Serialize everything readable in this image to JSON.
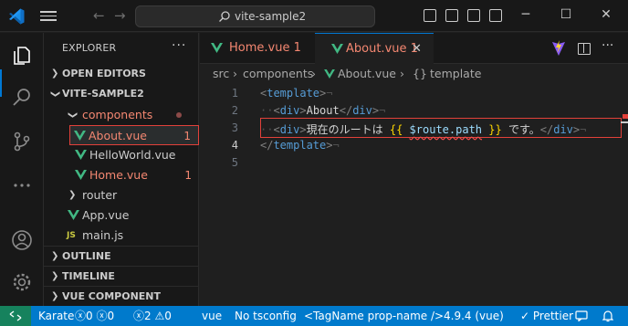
{
  "titlebar": {
    "search_text": "vite-sample2",
    "minimize": "─",
    "maximize": "☐",
    "close": "✕"
  },
  "sidebar": {
    "title": "EXPLORER",
    "sections": {
      "open_editors": "OPEN EDITORS",
      "project": "VITE-SAMPLE2",
      "outline": "OUTLINE",
      "timeline": "TIMELINE",
      "vue_preview": "VUE COMPONENT PREVIEW"
    },
    "tree": {
      "components": "components",
      "about": "About.vue",
      "about_badge": "1",
      "helloworld": "HelloWorld.vue",
      "home": "Home.vue",
      "home_badge": "1",
      "router": "router",
      "app": "App.vue",
      "main": "main.js",
      "js_label": "JS"
    }
  },
  "tabs": [
    {
      "label": "Home.vue 1"
    },
    {
      "label": "About.vue 1",
      "close": "✕"
    }
  ],
  "breadcrumb": {
    "src": "src",
    "components": "components",
    "file": "About.vue",
    "symbol": "template",
    "symbol_prefix": "{}"
  },
  "editor": {
    "line_numbers": [
      "1",
      "2",
      "3",
      "4",
      "5"
    ],
    "line1": {
      "open": "<",
      "tag": "template",
      "close": ">",
      "ws": "¬"
    },
    "line2": {
      "indent": "··",
      "open": "<",
      "tag": "div",
      "close": ">",
      "text": "About",
      "end_open": "</",
      "end_tag": "div",
      "end_close": ">",
      "ws": "¬"
    },
    "line3": {
      "indent": "··",
      "open": "<",
      "tag": "div",
      "close": ">",
      "text_before": "現在のルートは",
      "brace_open": "{{",
      "var": "$route.path",
      "brace_close": "}}",
      "text_after": "です。",
      "end_open": "</",
      "end_tag": "div",
      "end_close": ">",
      "ws": "¬"
    },
    "line4": {
      "open": "</",
      "tag": "template",
      "close": ">",
      "ws": "¬"
    }
  },
  "statusbar": {
    "remote_icon": "remote-icon",
    "karate": "Karate",
    "errors": "0",
    "warnings": "0",
    "problems_errors": "2",
    "problems_warnings": "0",
    "language": "vue",
    "tsconfig": "No tsconfig",
    "tag_format": "<TagName prop-name />",
    "version": "4.9.4 (vue)",
    "prettier": "Prettier"
  },
  "colors": {
    "accent": "#007acc",
    "error": "#e2413a",
    "vue_green": "#41b883",
    "modified_text": "#f48771"
  }
}
